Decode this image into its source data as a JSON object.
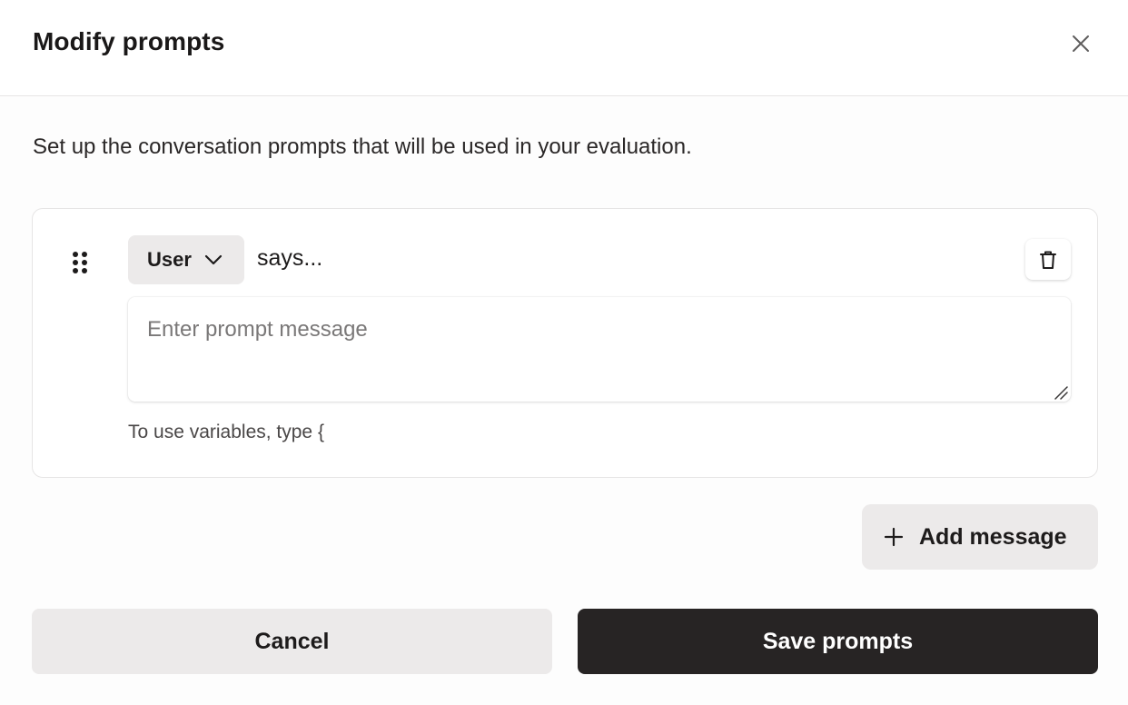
{
  "dialog": {
    "title": "Modify prompts",
    "subtitle": "Set up the conversation prompts that will be used in your evaluation."
  },
  "icons": {
    "close": "close-icon",
    "drag": "drag-handle-icon",
    "chevron": "chevron-down-icon",
    "delete": "trash-icon",
    "add": "plus-icon"
  },
  "prompts": [
    {
      "role": "User",
      "says_label": "says...",
      "message_value": "",
      "message_placeholder": "Enter prompt message"
    }
  ],
  "hint": "To use variables, type {",
  "actions": {
    "add_message": "Add message",
    "cancel": "Cancel",
    "save": "Save prompts"
  },
  "colors": {
    "primary_button_bg": "#272424",
    "secondary_button_bg": "#eceaea",
    "text": "#1d1b1b"
  }
}
